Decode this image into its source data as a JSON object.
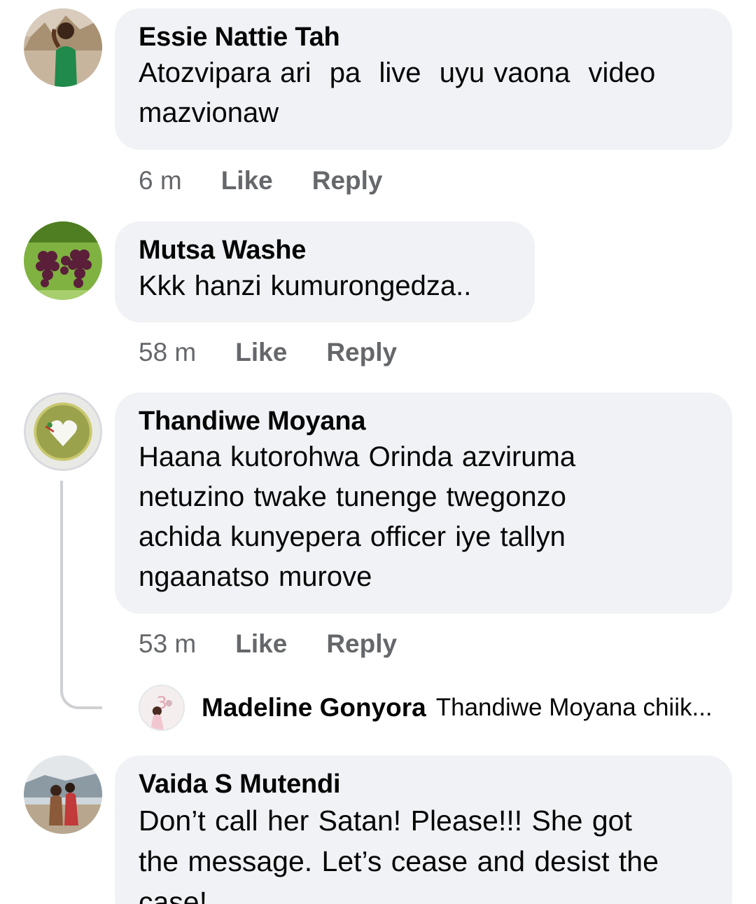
{
  "comments": [
    {
      "author": "Essie Nattie Tah",
      "text_lines": [
        "Atozvipara ari  pa  live  uyu vaona  video",
        "mazvionaw"
      ],
      "time": "6 m",
      "like_label": "Like",
      "reply_label": "Reply",
      "avatar_icon": "profile-photo-woman-green-dress"
    },
    {
      "author": "Mutsa Washe",
      "text_lines": [
        "Kkk hanzi kumurongedza.."
      ],
      "time": "58 m",
      "like_label": "Like",
      "reply_label": "Reply",
      "avatar_icon": "profile-photo-grapes"
    },
    {
      "author": "Thandiwe Moyana",
      "text_lines": [
        "Haana kutorohwa Orinda azviruma",
        "netuzino twake tunenge twegonzo",
        "achida kunyepera officer iye tallyn",
        "ngaanatso murove"
      ],
      "time": "53 m",
      "like_label": "Like",
      "reply_label": "Reply",
      "avatar_icon": "profile-photo-heart-plate"
    },
    {
      "author": "Vaida S Mutendi",
      "text_lines": [
        "Don’t call her Satan! Please!!! She got",
        "the message. Let’s cease and desist the",
        "case!"
      ],
      "avatar_icon": "profile-photo-two-people"
    }
  ],
  "reply_preview": {
    "author": "Madeline Gonyora",
    "text": "Thandiwe Moyana chiik...",
    "avatar_icon": "profile-photo-birthday-3"
  },
  "colors": {
    "bubble": "#f0f2f5",
    "meta_text": "#65676b",
    "thread_line": "#ced0d4"
  }
}
